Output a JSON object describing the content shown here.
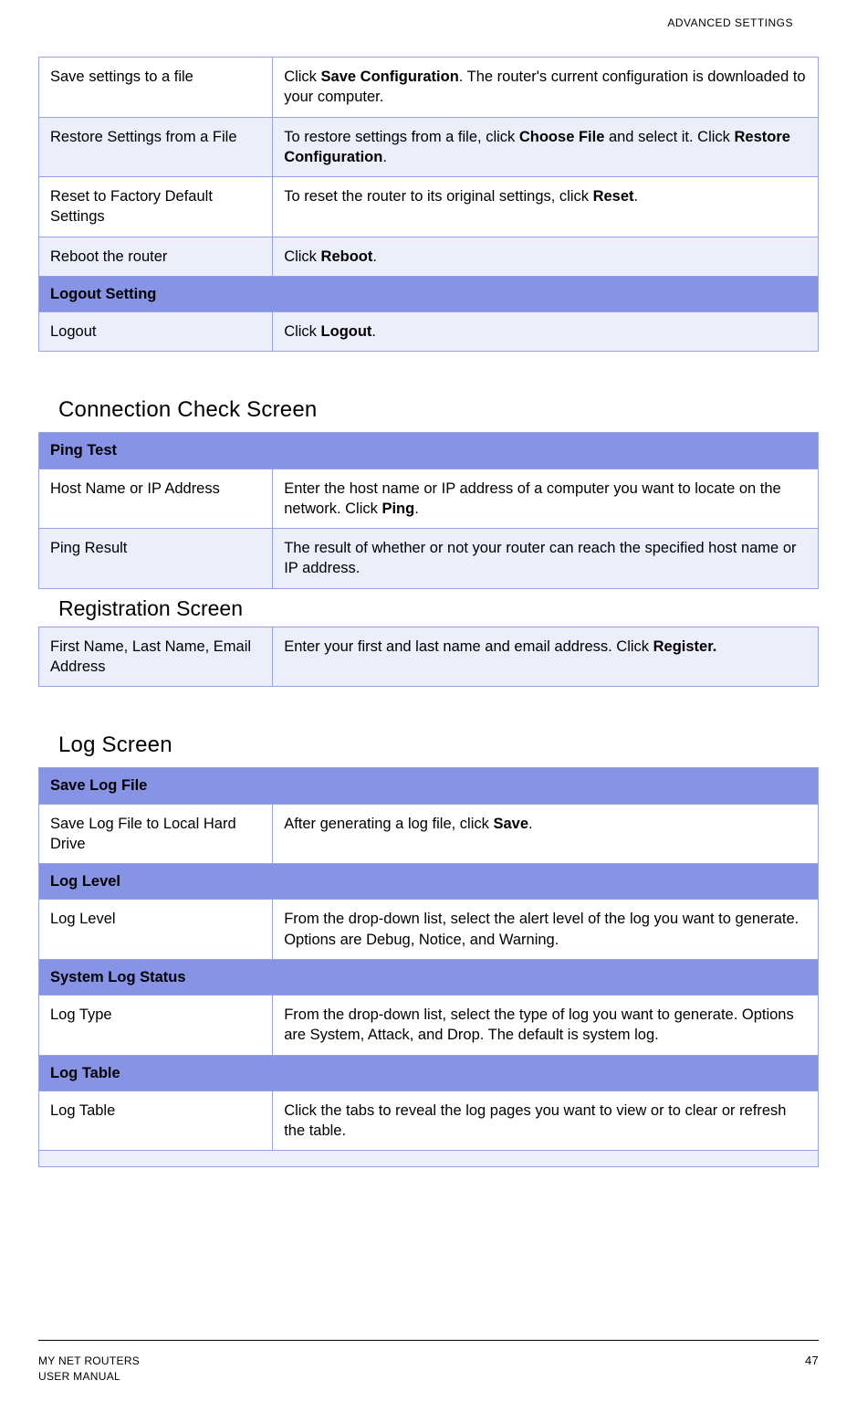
{
  "header": {
    "title": "ADVANCED SETTINGS"
  },
  "table1": {
    "rows": [
      {
        "left": "Save settings to a file",
        "right_pre": "Click ",
        "right_bold": "Save Configuration",
        "right_post": ". The router's current configuration is downloaded to your computer.",
        "shade": false
      },
      {
        "left": "Restore Settings from a File",
        "right_pre": "To restore settings from a file, click ",
        "right_bold": "Choose File",
        "right_mid": " and select it. Click ",
        "right_bold2": "Restore Configuration",
        "right_post": ".",
        "shade": true
      },
      {
        "left": "Reset to Factory Default Settings",
        "right_pre": "To reset the router to its original settings, click ",
        "right_bold": "Reset",
        "right_post": ".",
        "shade": false
      },
      {
        "left": "Reboot the router",
        "right_pre": "Click ",
        "right_bold": "Reboot",
        "right_post": ".",
        "shade": true
      }
    ],
    "section_header": "Logout Setting",
    "logout_row": {
      "left": "Logout",
      "right_pre": "Click ",
      "right_bold": "Logout",
      "right_post": "."
    }
  },
  "heading_connection": "Connection Check Screen",
  "table2": {
    "section_header": "Ping Test",
    "rows": [
      {
        "left": "Host Name or IP Address",
        "right_pre": "Enter the host name or IP address of a computer you want to locate on the network. Click ",
        "right_bold": "Ping",
        "right_post": ".",
        "shade": false
      },
      {
        "left": "Ping Result",
        "right_pre": "The result of whether or not your router can reach the specified host name or IP address.",
        "right_bold": "",
        "right_post": "",
        "shade": true
      }
    ]
  },
  "heading_registration": "Registration Screen",
  "table3": {
    "row": {
      "left": "First Name, Last Name, Email Address",
      "right_pre": "Enter your first and last name and email address. Click ",
      "right_bold": "Register.",
      "right_post": ""
    }
  },
  "heading_log": "Log Screen",
  "table4": {
    "section1": "Save Log File",
    "row1": {
      "left": "Save Log File to Local Hard Drive",
      "right_pre": "After generating a log file, click ",
      "right_bold": "Save",
      "right_post": "."
    },
    "section2": "Log Level",
    "row2": {
      "left": "Log Level",
      "right": "From the drop-down list, select the alert level of the log you want to generate. Options are Debug, Notice, and Warning."
    },
    "section3": "System Log Status",
    "row3": {
      "left": "Log Type",
      "right": "From the drop-down list, select the type of log you want to generate. Options are System, Attack, and Drop. The default is system log."
    },
    "section4": "Log Table",
    "row4": {
      "left": "Log Table",
      "right": "Click the tabs to reveal the log pages you want to view or to clear or refresh the table."
    }
  },
  "footer": {
    "left_line1": "MY NET ROUTERS",
    "left_line2": "USER MANUAL",
    "page_number": "47"
  }
}
